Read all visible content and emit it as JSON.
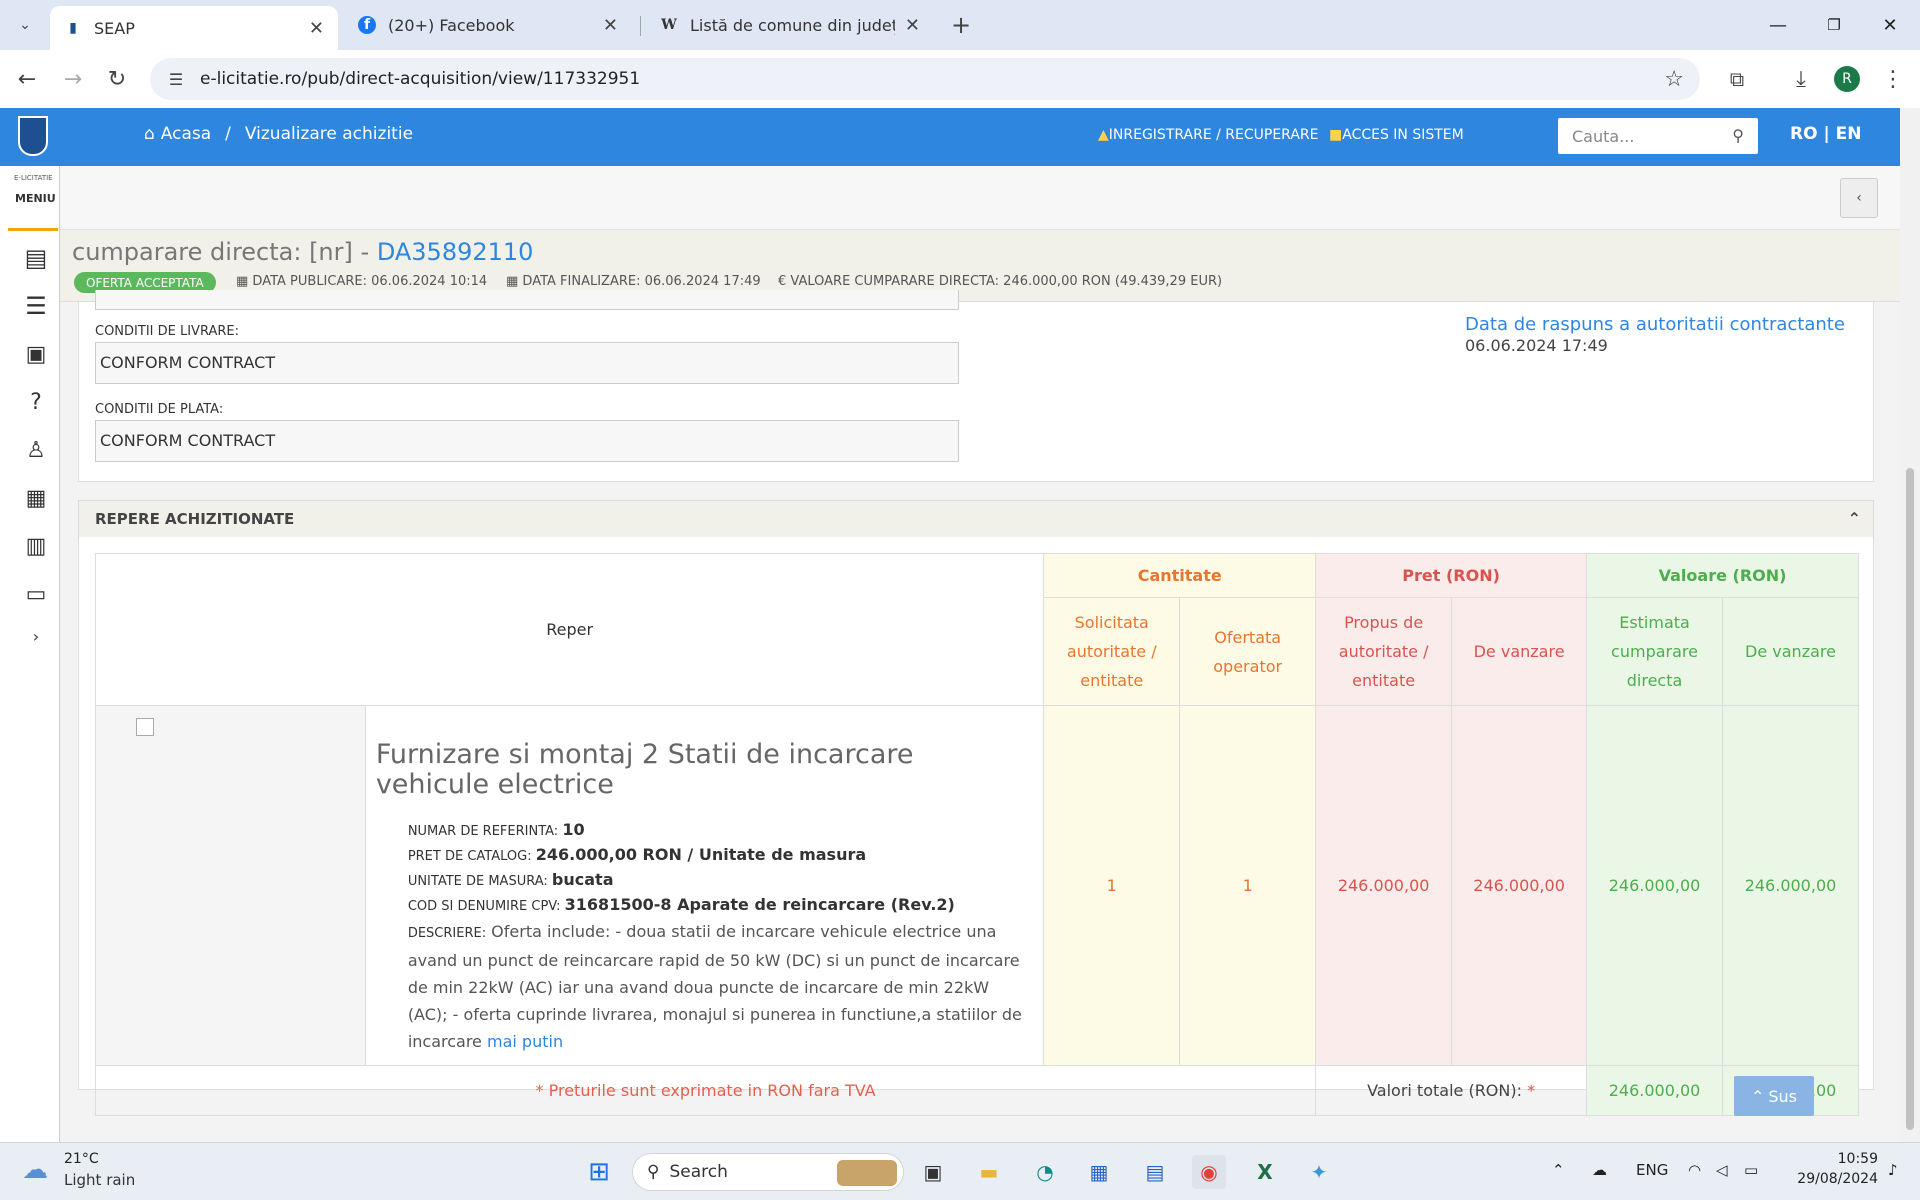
{
  "browser": {
    "tabs": [
      {
        "title": "SEAP",
        "icon": "seap-icon"
      },
      {
        "title": "(20+) Facebook",
        "icon": "facebook-icon"
      },
      {
        "title": "Listă de comune din județul Iași",
        "icon": "wikipedia-icon"
      }
    ],
    "new_tab": "+",
    "url": "e-licitatie.ro/pub/direct-acquisition/view/117332951",
    "profile_initial": "R"
  },
  "header": {
    "home": "Acasa",
    "separator": "/",
    "current": "Vizualizare achizitie",
    "register": "INREGISTRARE / RECUPERARE",
    "login": "ACCES IN SISTEM",
    "search_placeholder": "Cauta...",
    "lang": "RO | EN"
  },
  "menu": {
    "caption_small": "E-LICITATIE",
    "caption": "MENIU"
  },
  "title": {
    "prefix": "cumparare directa: [nr] -",
    "number": "DA35892110",
    "status": "OFERTA ACCEPTATA",
    "published": "DATA PUBLICARE: 06.06.2024 10:14",
    "finalized": "DATA FINALIZARE: 06.06.2024 17:49",
    "value": "€ VALOARE CUMPARARE DIRECTA: 246.000,00  RON (49.439,29  EUR)"
  },
  "conditions": {
    "delivery_label": "CONDITII DE LIVRARE:",
    "delivery_value": "CONFORM CONTRACT",
    "payment_label": "CONDITII DE PLATA:",
    "payment_value": "CONFORM CONTRACT",
    "response_label": "Data de raspuns a autoritatii contractante",
    "response_date": "06.06.2024 17:49"
  },
  "items": {
    "section_title": "REPERE ACHIZITIONATE",
    "col_reper": "Reper",
    "group_qty": "Cantitate",
    "group_price": "Pret (RON)",
    "group_value": "Valoare (RON)",
    "sub_requested": "Solicitata autoritate / entitate",
    "sub_offered": "Ofertata operator",
    "sub_proposed": "Propus de autoritate / entitate",
    "sub_sale_price": "De vanzare",
    "sub_estimated": "Estimata cumparare directa",
    "sub_sale_value": "De vanzare",
    "row": {
      "title": "Furnizare si montaj 2 Statii de incarcare vehicule electrice",
      "ref_label": "NUMAR DE REFERINTA:",
      "ref_value": "10",
      "catalog_label": "PRET DE CATALOG:",
      "catalog_value": "246.000,00  RON / Unitate de masura",
      "unit_label": "UNITATE DE MASURA:",
      "unit_value": "bucata",
      "cpv_label": "COD SI DENUMIRE CPV:",
      "cpv_value": "31681500-8 Aparate de reincarcare (Rev.2)",
      "desc_label": "DESCRIERE:",
      "desc_value": "Oferta include: - doua statii de incarcare vehicule electrice una avand un punct de reincarcare rapid de 50 kW (DC) si un punct de incarcare de min 22kW (AC) iar una avand doua puncte de incarcare de min 22kW (AC); - oferta cuprinde livrarea, monajul si punerea in functiune,a statiilor de incarcare",
      "less": "mai putin",
      "requested": "1",
      "offered": "1",
      "proposed": "246.000,00",
      "sale_price": "246.000,00",
      "estimated": "246.000,00",
      "sale_value": "246.000,00"
    },
    "note": "* Preturile sunt exprimate in RON fara TVA",
    "totals_label": "Valori totale (RON):",
    "totals_star": "*",
    "total_estimated": "246.000,00",
    "total_sale": "246.000,00",
    "back_top": "Sus"
  },
  "taskbar": {
    "temp": "21°C",
    "weather": "Light rain",
    "search": "Search",
    "lang": "ENG",
    "time": "10:59",
    "date": "29/08/2024"
  }
}
